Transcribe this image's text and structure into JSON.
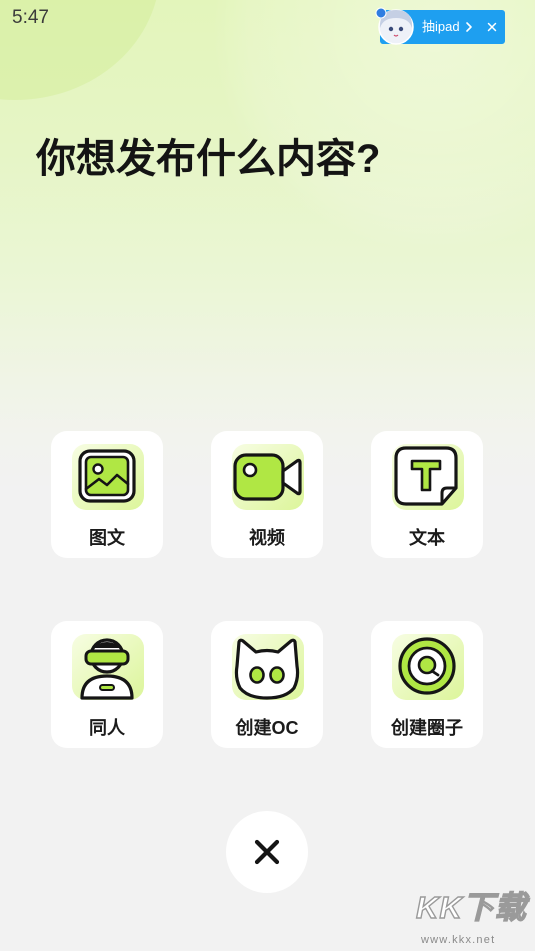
{
  "status_bar": {
    "time": "5:47"
  },
  "promo_banner": {
    "label": "抽ipad",
    "avatar_icon": "anime-character-avatar",
    "chevron_icon": "chevron-right-icon",
    "close_icon": "close-icon"
  },
  "title": "你想发布什么内容?",
  "options": [
    {
      "label": "图文",
      "icon": "image-icon"
    },
    {
      "label": "视频",
      "icon": "video-camera-icon"
    },
    {
      "label": "文本",
      "icon": "text-icon"
    },
    {
      "label": "同人",
      "icon": "vr-person-icon"
    },
    {
      "label": "创建OC",
      "icon": "cat-face-icon"
    },
    {
      "label": "创建圈子",
      "icon": "circle-chat-icon"
    }
  ],
  "close_button": {
    "icon": "close-icon"
  },
  "watermark": {
    "brand": "KK下载",
    "url": "www.kkx.net"
  },
  "colors": {
    "accent": "#b0e744",
    "icon_outline": "#151515",
    "banner": "#1e9ff0",
    "background_top": "#e3f5bb",
    "background_bottom": "#f2f2f2",
    "card": "#ffffff"
  }
}
